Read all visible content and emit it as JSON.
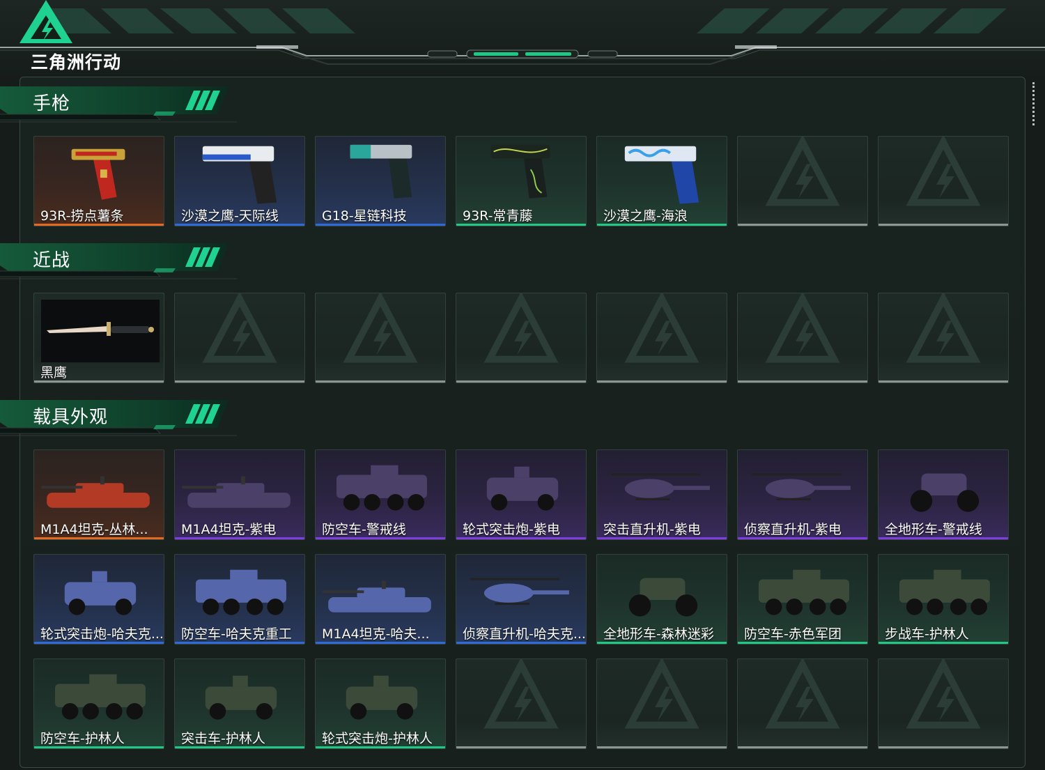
{
  "app": {
    "logo_text": "三角洲行动"
  },
  "colors": {
    "orange": "#e46a24",
    "blue": "#2f6bd8",
    "purple": "#7f3fe0",
    "green": "#1fc985",
    "empty": "#8c9693"
  },
  "sections": {
    "pistols": {
      "title": "手枪",
      "items": [
        {
          "name": "93R-捞点薯条",
          "quality": "orange",
          "icon": "pistol-gold-red-icon"
        },
        {
          "name": "沙漠之鹰-天际线",
          "quality": "blue",
          "icon": "pistol-white-blue-icon"
        },
        {
          "name": "G18-星链科技",
          "quality": "blue",
          "icon": "pistol-teal-icon"
        },
        {
          "name": "93R-常青藤",
          "quality": "green",
          "icon": "pistol-vine-icon"
        },
        {
          "name": "沙漠之鹰-海浪",
          "quality": "green",
          "icon": "pistol-wave-icon"
        },
        {
          "name": "",
          "quality": "empty"
        },
        {
          "name": "",
          "quality": "empty"
        }
      ]
    },
    "melee": {
      "title": "近战",
      "items": [
        {
          "name": "黑鹰",
          "quality": "empty",
          "icon": "knife-icon"
        },
        {
          "name": "",
          "quality": "empty"
        },
        {
          "name": "",
          "quality": "empty"
        },
        {
          "name": "",
          "quality": "empty"
        },
        {
          "name": "",
          "quality": "empty"
        },
        {
          "name": "",
          "quality": "empty"
        },
        {
          "name": "",
          "quality": "empty"
        }
      ]
    },
    "vehicles": {
      "title": "载具外观",
      "items": [
        {
          "name": "M1A4坦克-丛林...",
          "quality": "orange",
          "icon": "tank-icon"
        },
        {
          "name": "M1A4坦克-紫电",
          "quality": "purple",
          "icon": "tank-icon"
        },
        {
          "name": "防空车-警戒线",
          "quality": "purple",
          "icon": "aa-vehicle-icon"
        },
        {
          "name": "轮式突击炮-紫电",
          "quality": "purple",
          "icon": "assault-gun-icon"
        },
        {
          "name": "突击直升机-紫电",
          "quality": "purple",
          "icon": "attack-helicopter-icon"
        },
        {
          "name": "侦察直升机-紫电",
          "quality": "purple",
          "icon": "scout-helicopter-icon"
        },
        {
          "name": "全地形车-警戒线",
          "quality": "purple",
          "icon": "atv-icon"
        },
        {
          "name": "轮式突击炮-哈夫克...",
          "quality": "blue",
          "icon": "assault-gun-icon"
        },
        {
          "name": "防空车-哈夫克重工",
          "quality": "blue",
          "icon": "aa-vehicle-icon"
        },
        {
          "name": "M1A4坦克-哈夫...",
          "quality": "blue",
          "icon": "tank-icon"
        },
        {
          "name": "侦察直升机-哈夫克...",
          "quality": "blue",
          "icon": "scout-helicopter-icon"
        },
        {
          "name": "全地形车-森林迷彩",
          "quality": "green",
          "icon": "atv-icon"
        },
        {
          "name": "防空车-赤色军团",
          "quality": "green",
          "icon": "aa-vehicle-icon"
        },
        {
          "name": "步战车-护林人",
          "quality": "green",
          "icon": "ifv-icon"
        },
        {
          "name": "防空车-护林人",
          "quality": "green",
          "icon": "aa-vehicle-icon"
        },
        {
          "name": "突击车-护林人",
          "quality": "green",
          "icon": "assault-vehicle-icon"
        },
        {
          "name": "轮式突击炮-护林人",
          "quality": "green",
          "icon": "assault-gun-icon"
        },
        {
          "name": "",
          "quality": "empty"
        },
        {
          "name": "",
          "quality": "empty"
        },
        {
          "name": "",
          "quality": "empty"
        },
        {
          "name": "",
          "quality": "empty"
        }
      ]
    }
  }
}
